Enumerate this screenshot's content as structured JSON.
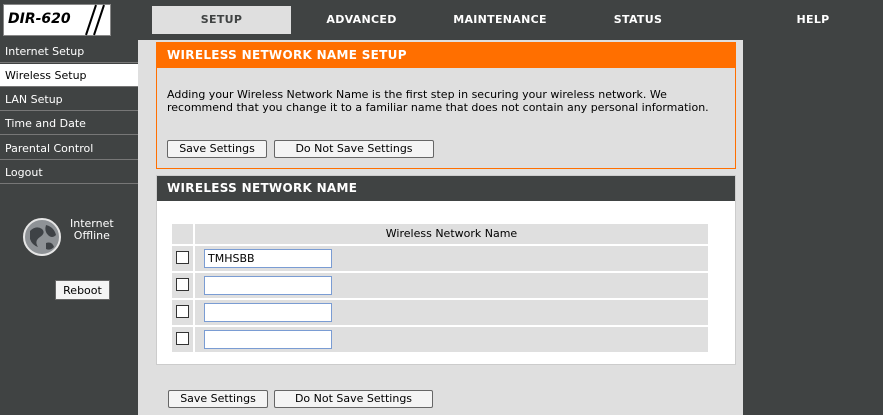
{
  "logo": {
    "text": "DIR-620"
  },
  "tabs": [
    {
      "label": "SETUP"
    },
    {
      "label": "ADVANCED"
    },
    {
      "label": "MAINTENANCE"
    },
    {
      "label": "STATUS"
    },
    {
      "label": "HELP"
    }
  ],
  "sidebar": {
    "items": [
      {
        "label": "Internet Setup"
      },
      {
        "label": "Wireless Setup"
      },
      {
        "label": "LAN Setup"
      },
      {
        "label": "Time and Date"
      },
      {
        "label": "Parental Control"
      },
      {
        "label": "Logout"
      }
    ],
    "status_line1": "Internet",
    "status_line2": "Offline",
    "reboot_label": "Reboot"
  },
  "setup_box": {
    "title": "WIRELESS NETWORK NAME SETUP",
    "description": "Adding your Wireless Network Name is the first step in securing your wireless network. We recommend that you change it to a familiar name that does not contain any personal information.",
    "save_label": "Save Settings",
    "nosave_label": "Do Not Save Settings"
  },
  "name_box": {
    "title": "WIRELESS NETWORK NAME",
    "column_header": "Wireless Network Name",
    "rows": [
      {
        "checked": false,
        "value": "TMHSBB"
      },
      {
        "checked": false,
        "value": ""
      },
      {
        "checked": false,
        "value": ""
      },
      {
        "checked": false,
        "value": ""
      }
    ]
  },
  "bottom": {
    "save_label": "Save Settings",
    "nosave_label": "Do Not Save Settings"
  },
  "colors": {
    "accent": "#ff6f00",
    "dark": "#404343",
    "panel": "#dfdfdf"
  }
}
